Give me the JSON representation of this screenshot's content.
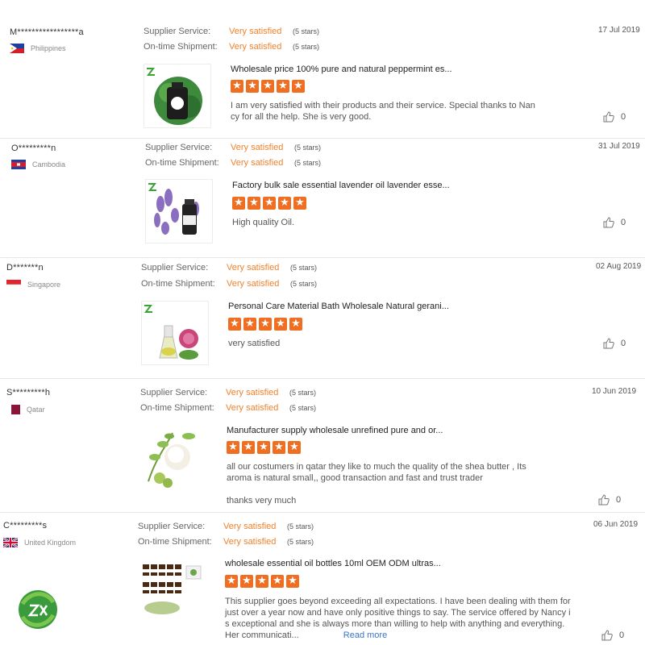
{
  "colors": {
    "accent": "#f0822d",
    "star_bg": "#ef6e22",
    "link": "#3b74c9"
  },
  "labels": {
    "supplier_service": "Supplier Service:",
    "ontime_shipment": "On-time Shipment:"
  },
  "reviews": [
    {
      "buyer": "M*****************a",
      "country": "Philippines",
      "flag": "philippines-flag",
      "supplier_service": "Very satisfied",
      "supplier_stars": "(5 stars)",
      "ontime": "Very satisfied",
      "ontime_stars": "(5 stars)",
      "date": "17 Jul 2019",
      "product": "Wholesale price 100% pure and natural peppermint es...",
      "rating": 5,
      "comment_lines": [
        "I am very satisfied with their products and their service. Special thanks to Nan",
        "cy for all the help. She is very good."
      ],
      "likes": "0"
    },
    {
      "buyer": "O*********n",
      "country": "Cambodia",
      "flag": "cambodia-flag",
      "supplier_service": "Very satisfied",
      "supplier_stars": "(5 stars)",
      "ontime": "Very satisfied",
      "ontime_stars": "(5 stars)",
      "date": "31 Jul 2019",
      "product": "Factory bulk sale essential lavender oil lavender esse...",
      "rating": 5,
      "comment_lines": [
        "High quality Oil."
      ],
      "likes": "0"
    },
    {
      "buyer": "D*******n",
      "country": "Singapore",
      "flag": "singapore-flag",
      "supplier_service": "Very satisfied",
      "supplier_stars": "(5 stars)",
      "ontime": "Very satisfied",
      "ontime_stars": "(5 stars)",
      "date": "02 Aug 2019",
      "product": "Personal Care Material Bath Wholesale Natural gerani...",
      "rating": 5,
      "comment_lines": [
        "very satisfied"
      ],
      "likes": "0"
    },
    {
      "buyer": "S*********h",
      "country": "Qatar",
      "flag": "qatar-flag",
      "supplier_service": "Very satisfied",
      "supplier_stars": "(5 stars)",
      "ontime": "Very satisfied",
      "ontime_stars": "(5 stars)",
      "date": "10 Jun 2019",
      "product": "Manufacturer supply wholesale unrefined pure and or...",
      "rating": 5,
      "comment_lines": [
        "all our costumers in qatar they like to much the quality of the shea butter ,  Its",
        "aroma is natural small,, good transaction and fast and trust trader",
        "",
        "thanks very much"
      ],
      "likes": "0"
    },
    {
      "buyer": "C*********s",
      "country": "United Kingdom",
      "flag": "uk-flag",
      "supplier_service": "Very satisfied",
      "supplier_stars": "(5 stars)",
      "ontime": "Very satisfied",
      "ontime_stars": "(5 stars)",
      "date": "06 Jun 2019",
      "product": "wholesale essential oil bottles 10ml OEM ODM ultras...",
      "rating": 5,
      "comment_lines": [
        "This supplier goes beyond exceeding all expectations. I have been dealing with them for",
        "just over a year now and have only positive things to say. The service offered by Nancy i",
        "s exceptional and she is always more than willing to help with anything and everything.",
        "Her communicati..."
      ],
      "read_more": "Read more",
      "likes": "0"
    }
  ]
}
